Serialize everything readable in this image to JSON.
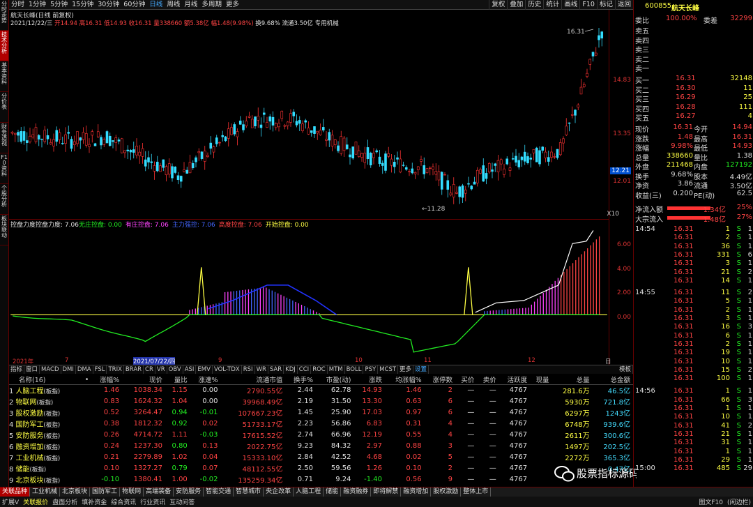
{
  "left_tabs": [
    "分时走势",
    "技术分析",
    "基本资料",
    "分价表",
    "财务透视",
    "F10资料",
    "个股分析",
    "板块联动"
  ],
  "left_active": 1,
  "toolbar": [
    "分时",
    "1分钟",
    "5分钟",
    "15分钟",
    "30分钟",
    "60分钟",
    "日线",
    "周线",
    "月线",
    "多周期",
    "更多"
  ],
  "toolbar_active": 6,
  "toolbar_right": [
    "复权",
    "叠加",
    "历史",
    "统计",
    "画线",
    "F10",
    "标记",
    "返回"
  ],
  "header": {
    "title": "航天长峰(日线 前复权)",
    "info_date": "2021/12/22/三",
    "info_kline": "开14.94 高16.31 低14.93 收16.31 量338660 额5.38亿 幅1.48(9.98%)",
    "info_extra": "换9.68% 流通3.50亿 专用机械"
  },
  "main_chart": {
    "max_label": "16.31",
    "min_label": "11.28",
    "y_ticks": [
      "14.83",
      "13.35",
      "12.01"
    ],
    "current_price": "12.21",
    "marker": "10",
    "tick_xmark": "X10"
  },
  "sub_chart": {
    "title": "控盘力度",
    "value_label": "控盘力度: 7.06",
    "items": [
      {
        "name": "无庄控盘: 0.00",
        "color": "#22ee22"
      },
      {
        "name": "有庄控盘: 7.06",
        "color": "#ff44ff"
      },
      {
        "name": "主力强控: 7.06",
        "color": "#4466ff"
      },
      {
        "name": "高度控盘: 7.06",
        "color": "#ff4444"
      },
      {
        "name": "开始控盘: 0.00",
        "color": "#ffff44"
      }
    ],
    "y_ticks": [
      "6.00",
      "4.00",
      "2.00",
      "0.00"
    ]
  },
  "dates": [
    "2021年",
    "7",
    "2021/07/22/四",
    "9",
    "10",
    "11",
    "12",
    "日线"
  ],
  "index_tabs": [
    "指标",
    "窗口",
    "MACD",
    "DMI",
    "DMA",
    "FSL",
    "TRIX",
    "BRAR",
    "CR",
    "VR",
    "OBV",
    "ASI",
    "EMV",
    "VOL-TDX",
    "RSI",
    "WR",
    "SAR",
    "KDJ",
    "CCI",
    "ROC",
    "MTM",
    "BOLL",
    "PSY",
    "MCST",
    "更多",
    "设置"
  ],
  "index_right": "模板",
  "table": {
    "headers": [
      "名称(16)",
      "•",
      "涨幅%",
      "现价",
      "量比",
      "涨速%",
      "流通市值",
      "换手%",
      "市盈(动)",
      "涨跌",
      "均涨幅%",
      "涨停数",
      "买价",
      "卖价",
      "活跃度",
      "现量",
      "总量",
      "总金额"
    ],
    "rows": [
      [
        "1",
        "人脑工程",
        "1.46",
        "1038.34",
        "1.15",
        "0.00",
        "2790.55亿",
        "2.44",
        "62.78",
        "14.93",
        "1.46",
        "2",
        "—",
        "—",
        "4767",
        "",
        "281.6万",
        "46.5亿"
      ],
      [
        "2",
        "物联网",
        "0.83",
        "1624.32",
        "1.04",
        "0.00",
        "39968.49亿",
        "2.19",
        "31.50",
        "13.30",
        "0.63",
        "6",
        "—",
        "—",
        "4767",
        "",
        "5930万",
        "721.8亿"
      ],
      [
        "3",
        "股权激励",
        "0.52",
        "3264.47",
        "0.94",
        "-0.01",
        "107667.23亿",
        "1.45",
        "25.90",
        "17.03",
        "0.97",
        "6",
        "—",
        "—",
        "4767",
        "",
        "6297万",
        "1243亿"
      ],
      [
        "4",
        "国防军工",
        "0.38",
        "1812.32",
        "0.92",
        "0.02",
        "51733.17亿",
        "2.23",
        "56.86",
        "6.83",
        "0.31",
        "4",
        "—",
        "—",
        "4767",
        "",
        "6748万",
        "939.6亿"
      ],
      [
        "5",
        "安防服务",
        "0.26",
        "4714.72",
        "1.11",
        "-0.03",
        "17615.52亿",
        "2.74",
        "66.96",
        "12.19",
        "0.55",
        "4",
        "—",
        "—",
        "4767",
        "",
        "2611万",
        "300.6亿"
      ],
      [
        "6",
        "融资增加",
        "0.24",
        "1237.30",
        "0.80",
        "0.13",
        "2022.75亿",
        "9.23",
        "84.32",
        "2.97",
        "0.88",
        "3",
        "—",
        "—",
        "4767",
        "",
        "1497万",
        "202.5亿"
      ],
      [
        "7",
        "工业机械",
        "0.21",
        "2279.89",
        "1.02",
        "0.04",
        "15333.10亿",
        "2.84",
        "42.52",
        "4.68",
        "0.02",
        "5",
        "—",
        "—",
        "4767",
        "",
        "2272万",
        "365.3亿"
      ],
      [
        "8",
        "储能",
        "0.10",
        "1327.27",
        "0.79",
        "0.07",
        "48112.55亿",
        "2.50",
        "59.56",
        "1.26",
        "0.10",
        "2",
        "—",
        "—",
        "4767",
        "",
        "",
        "0.47亿"
      ],
      [
        "9",
        "北京板块",
        "-0.10",
        "1380.41",
        "1.00",
        "-0.02",
        "135259.34亿",
        "0.71",
        "9.24",
        "-1.40",
        "0.56",
        "9",
        "—",
        "—",
        "4767",
        "",
        "",
        ""
      ]
    ],
    "board_tag": "(板指)"
  },
  "bottom_tabs": [
    "关联品种",
    "工业机械",
    "北京板块",
    "国防军工",
    "物联网",
    "高端装备",
    "安防服务",
    "智能交通",
    "智慧城市",
    "央企改革",
    "人脑工程",
    "储能",
    "融资融券",
    "即将解禁",
    "融资增加",
    "股权激励",
    "整体上市"
  ],
  "status": [
    "扩展V",
    "关联报价",
    "盘面分析",
    "填补资金",
    "综合资讯",
    "行业资讯",
    "互动问答"
  ],
  "status_right": [
    "图文F10",
    "(闲边栏)"
  ],
  "right_panel": {
    "code": "600855",
    "name": "航天长峰",
    "weibi_label": "委比",
    "weibi": "100.00%",
    "weicha_label": "委差",
    "weicha": "32299",
    "asks": [
      [
        "卖五",
        "",
        ""
      ],
      [
        "卖四",
        "",
        ""
      ],
      [
        "卖三",
        "",
        ""
      ],
      [
        "卖二",
        "",
        ""
      ],
      [
        "卖一",
        "",
        ""
      ]
    ],
    "bids": [
      [
        "买一",
        "16.31",
        "32148"
      ],
      [
        "买二",
        "16.30",
        "11"
      ],
      [
        "买三",
        "16.29",
        "25"
      ],
      [
        "买四",
        "16.28",
        "111"
      ],
      [
        "买五",
        "16.27",
        "4"
      ]
    ],
    "stats": [
      [
        "现价",
        "16.31",
        "今开",
        "14.94"
      ],
      [
        "涨跌",
        "1.48",
        "最高",
        "16.31"
      ],
      [
        "涨幅",
        "9.98%",
        "最低",
        "14.93"
      ],
      [
        "总量",
        "338660",
        "量比",
        "1.38"
      ],
      [
        "外盘",
        "211468",
        "内盘",
        "127192"
      ],
      [
        "换手",
        "9.68%",
        "股本",
        "4.49亿"
      ],
      [
        "净资",
        "3.86",
        "流通",
        "3.50亿"
      ],
      [
        "收益(三)",
        "0.200",
        "PE(动)",
        "62.5"
      ]
    ],
    "flows": [
      [
        "净流入额",
        "1.34亿",
        "25%"
      ],
      [
        "大宗流入",
        "1.48亿",
        "27%"
      ]
    ],
    "ticks": [
      [
        "14:54",
        "16.31",
        "1",
        "S",
        "1"
      ],
      [
        "",
        "16.31",
        "2",
        "S",
        "1"
      ],
      [
        "",
        "16.31",
        "36",
        "S",
        "1"
      ],
      [
        "",
        "16.31",
        "331",
        "S",
        "6"
      ],
      [
        "",
        "16.31",
        "3",
        "S",
        "1"
      ],
      [
        "",
        "16.31",
        "21",
        "S",
        "2"
      ],
      [
        "",
        "16.31",
        "14",
        "S",
        "1"
      ],
      [
        "14:55",
        "16.31",
        "11",
        "S",
        "2"
      ],
      [
        "",
        "16.31",
        "5",
        "S",
        "1"
      ],
      [
        "",
        "16.31",
        "2",
        "S",
        "1"
      ],
      [
        "",
        "16.31",
        "3",
        "S",
        "1"
      ],
      [
        "",
        "16.31",
        "16",
        "S",
        "3"
      ],
      [
        "",
        "16.31",
        "6",
        "S",
        "1"
      ],
      [
        "",
        "16.31",
        "2",
        "S",
        "1"
      ],
      [
        "",
        "16.31",
        "19",
        "S",
        "1"
      ],
      [
        "",
        "16.31",
        "10",
        "S",
        "1"
      ],
      [
        "",
        "16.31",
        "15",
        "S",
        "2"
      ],
      [
        "",
        "16.31",
        "100",
        "S",
        "1"
      ],
      [
        "14:56",
        "16.31",
        "1",
        "S",
        "1"
      ],
      [
        "",
        "16.31",
        "66",
        "S",
        "3"
      ],
      [
        "",
        "16.31",
        "1",
        "S",
        "1"
      ],
      [
        "",
        "16.31",
        "10",
        "S",
        "1"
      ],
      [
        "",
        "16.31",
        "41",
        "S",
        "2"
      ],
      [
        "",
        "16.31",
        "21",
        "S",
        "1"
      ],
      [
        "",
        "16.31",
        "31",
        "S",
        "1"
      ],
      [
        "",
        "16.31",
        "1",
        "S",
        "1"
      ],
      [
        "",
        "16.31",
        "29",
        "S",
        "1"
      ],
      [
        "15:00",
        "16.31",
        "485",
        "S",
        "29"
      ]
    ]
  },
  "watermark": "股票指标源码分享"
}
